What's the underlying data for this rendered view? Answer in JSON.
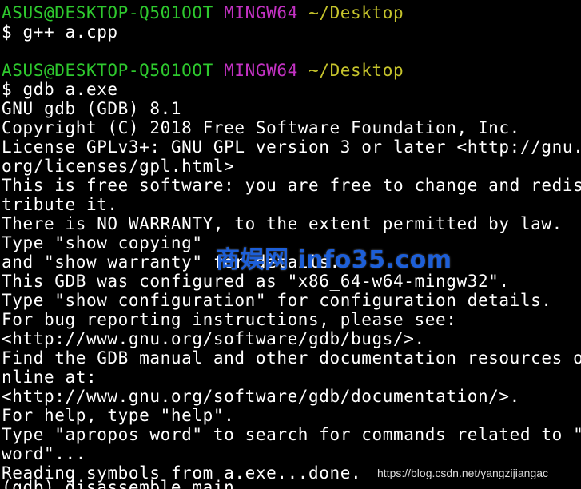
{
  "terminal": {
    "colors": {
      "background": "#000000",
      "text": "#ffffff",
      "prompt_user": "#2ec92e",
      "prompt_env": "#c232c2",
      "prompt_path": "#c6c42c"
    },
    "prompt1": {
      "user": "ASUS@DESKTOP-Q501OOT",
      "env": "MINGW64",
      "path": "~/Desktop",
      "command": "$ g++ a.cpp"
    },
    "prompt2": {
      "user": "ASUS@DESKTOP-Q501OOT",
      "env": "MINGW64",
      "path": "~/Desktop",
      "command": "$ gdb a.exe"
    },
    "output": [
      "GNU gdb (GDB) 8.1",
      "Copyright (C) 2018 Free Software Foundation, Inc.",
      "License GPLv3+: GNU GPL version 3 or later <http://gnu.",
      "org/licenses/gpl.html>",
      "This is free software: you are free to change and redis",
      "tribute it.",
      "There is NO WARRANTY, to the extent permitted by law.",
      "Type \"show copying\"",
      "and \"show warranty\" for details.",
      "This GDB was configured as \"x86_64-w64-mingw32\".",
      "Type \"show configuration\" for configuration details.",
      "For bug reporting instructions, please see:",
      "<http://www.gnu.org/software/gdb/bugs/>.",
      "Find the GDB manual and other documentation resources o",
      "nline at:",
      "<http://www.gnu.org/software/gdb/documentation/>.",
      "For help, type \"help\".",
      "Type \"apropos word\" to search for commands related to \"",
      "word\"...",
      "Reading symbols from a.exe...done."
    ],
    "partial_line": "(gdb) disassemble main"
  },
  "watermarks": {
    "site": "商娱网 info35.com",
    "blog": "https://blog.csdn.net/yangzijiangac"
  }
}
